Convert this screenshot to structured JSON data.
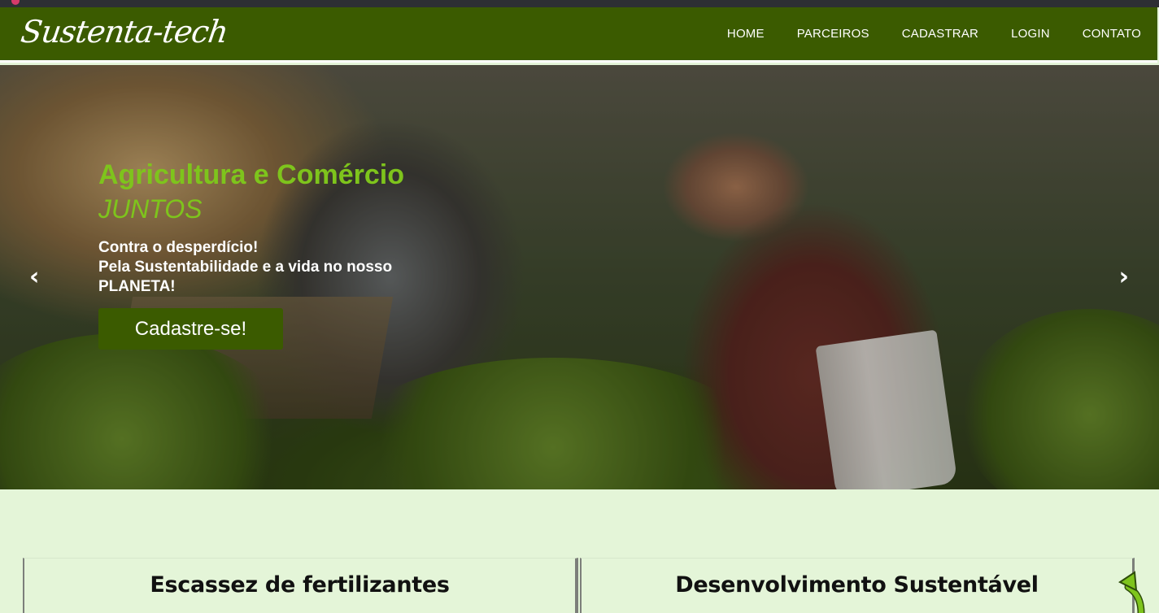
{
  "header": {
    "logo": "Sustenta-tech",
    "nav": [
      "HOME",
      "PARCEIROS",
      "CADASTRAR",
      "LOGIN",
      "CONTATO"
    ]
  },
  "hero": {
    "title": "Agricultura e Comércio",
    "subtitle": "JUNTOS",
    "lines": [
      "Contra o desperdício!",
      "Pela Sustentabilidade e a vida no nosso",
      "PLANETA!"
    ],
    "cta": "Cadastre-se!",
    "prev_icon": "‹",
    "next_icon": "›"
  },
  "cards": [
    {
      "title": "Escassez de fertilizantes"
    },
    {
      "title": "Desenvolvimento Sustentável"
    }
  ],
  "icons": {
    "back_to_top": "back-to-top-arrow-icon"
  },
  "colors": {
    "brand_green": "#3b5b00",
    "accent_green": "#7ec41c",
    "page_bg": "#e4f5d8"
  }
}
